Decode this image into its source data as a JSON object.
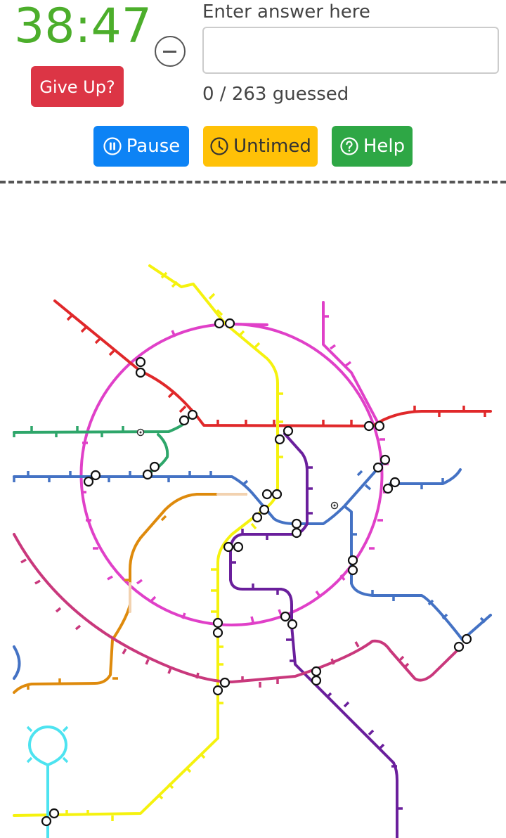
{
  "timer": {
    "value": "38:47",
    "color": "#4cae2b"
  },
  "give_up": {
    "label": "Give Up?"
  },
  "answer": {
    "label": "Enter answer here",
    "value": "",
    "placeholder": ""
  },
  "progress": {
    "text": "0 / 263 guessed",
    "guessed": 0,
    "total": 263
  },
  "buttons": {
    "pause": {
      "label": "Pause",
      "icon": "pause-circle-icon"
    },
    "untimed": {
      "label": "Untimed",
      "icon": "clock-icon"
    },
    "help": {
      "label": "Help",
      "icon": "question-circle-icon"
    }
  },
  "colors": {
    "pause": "#0d83f5",
    "untimed": "#ffc107",
    "help": "#2ea745",
    "give_up": "#dc3545"
  },
  "map": {
    "lines": [
      {
        "id": "red",
        "color": "#e0282a"
      },
      {
        "id": "magenta-ring",
        "color": "#e040c8"
      },
      {
        "id": "yellow",
        "color": "#f5f20e"
      },
      {
        "id": "green",
        "color": "#2ea66a"
      },
      {
        "id": "blue",
        "color": "#4472c4"
      },
      {
        "id": "purple",
        "color": "#6a1f9c"
      },
      {
        "id": "orange",
        "color": "#de8a0c"
      },
      {
        "id": "crimson",
        "color": "#c9387c"
      },
      {
        "id": "cyan",
        "color": "#4de3f0"
      }
    ]
  }
}
